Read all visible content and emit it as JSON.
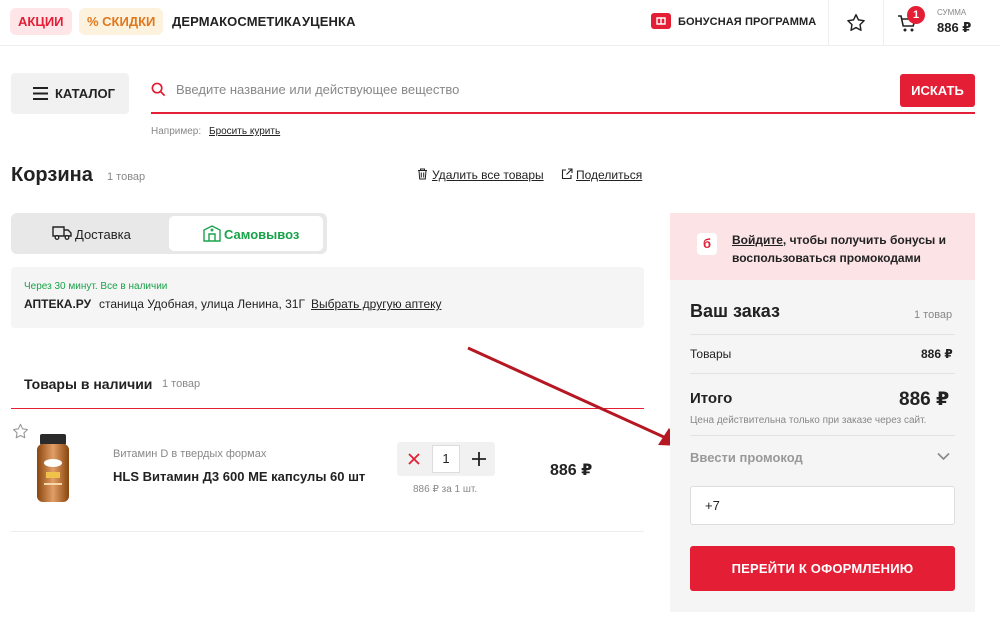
{
  "topbar": {
    "sale_label": "АКЦИИ",
    "discount_label": "% СКИДКИ",
    "derma_label": "ДЕРМАКОСМЕТИКА",
    "markdown_label": "УЦЕНКА",
    "bonus_label": "БОНУСНАЯ ПРОГРАММА",
    "cart_count": "1",
    "sum_caption": "СУММА",
    "sum_value": "886 ₽"
  },
  "search": {
    "catalog_label": "КАТАЛОГ",
    "placeholder": "Введите название или действующее вещество",
    "button_label": "ИСКАТЬ",
    "example_prefix": "Например:",
    "example_link": "Бросить курить"
  },
  "cart": {
    "title": "Корзина",
    "count": "1 товар",
    "delete_all": "Удалить все товары",
    "share": "Поделиться",
    "delivery_tab": "Доставка",
    "pickup_tab": "Самовывоз",
    "pickup_note": "Через 30 минут. Все в наличии",
    "pharmacy_name": "АПТЕКА.РУ",
    "pharmacy_address": "станица Удобная, улица Ленина, 31Г",
    "change_pharmacy": "Выбрать другую аптеку",
    "section_title": "Товары в наличии",
    "section_count": "1 товар"
  },
  "item": {
    "category": "Витамин D в твердых формах",
    "name": "HLS Витамин Д3 600 МЕ капсулы 60 шт",
    "quantity": "1",
    "unit_price": "886 ₽ за 1 шт.",
    "price": "886 ₽"
  },
  "order": {
    "login_link": "Войдите",
    "login_text_1": ", чтобы получить бонусы и",
    "login_text_2": "воспользоваться промокодами",
    "title": "Ваш заказ",
    "count": "1 товар",
    "goods_label": "Товары",
    "goods_value": "886 ₽",
    "total_label": "Итого",
    "total_value": "886 ₽",
    "price_note": "Цена действительна только при заказе через сайт.",
    "promo_label": "Ввести промокод",
    "phone_value": "+7",
    "checkout_label": "ПЕРЕЙТИ К ОФОРМЛЕНИЮ"
  },
  "colors": {
    "accent": "#e31e35",
    "pickup_green": "#1aa34a",
    "panel_pink": "#fbe3e6",
    "panel_grey": "#f5f5f5"
  }
}
